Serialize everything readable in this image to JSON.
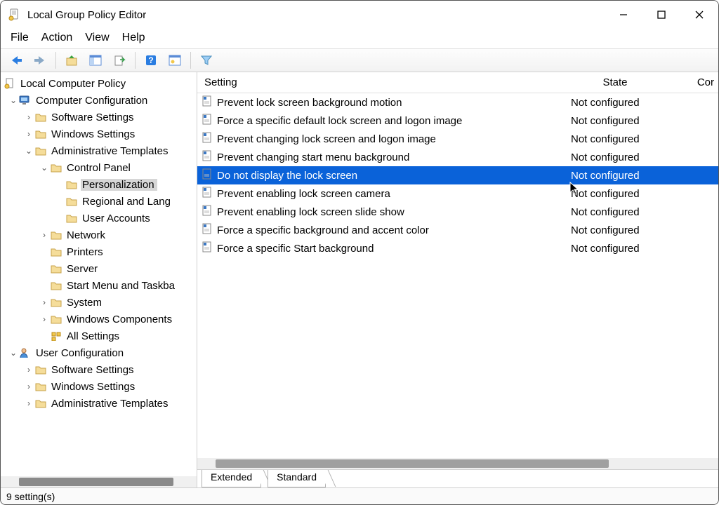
{
  "window": {
    "title": "Local Group Policy Editor"
  },
  "menu": {
    "file": "File",
    "action": "Action",
    "view": "View",
    "help": "Help"
  },
  "tree": {
    "root": "Local Computer Policy",
    "computer_cfg": "Computer Configuration",
    "sw_settings": "Software Settings",
    "win_settings": "Windows Settings",
    "admin_templates": "Administrative Templates",
    "control_panel": "Control Panel",
    "personalization": "Personalization",
    "regional": "Regional and Lang",
    "user_accounts": "User Accounts",
    "network": "Network",
    "printers": "Printers",
    "server": "Server",
    "startmenu": "Start Menu and Taskba",
    "system": "System",
    "win_components": "Windows Components",
    "all_settings": "All Settings",
    "user_cfg": "User Configuration",
    "u_sw_settings": "Software Settings",
    "u_win_settings": "Windows Settings",
    "u_admin_templates": "Administrative Templates"
  },
  "columns": {
    "setting": "Setting",
    "state": "State",
    "comment": "Cor"
  },
  "state_text": {
    "not_configured": "Not configured"
  },
  "settings": [
    {
      "name": "Prevent lock screen background motion"
    },
    {
      "name": "Force a specific default lock screen and logon image"
    },
    {
      "name": "Prevent changing lock screen and logon image"
    },
    {
      "name": "Prevent changing start menu background"
    },
    {
      "name": "Do not display the lock screen",
      "selected": true
    },
    {
      "name": "Prevent enabling lock screen camera"
    },
    {
      "name": "Prevent enabling lock screen slide show"
    },
    {
      "name": "Force a specific background and accent color"
    },
    {
      "name": "Force a specific Start background"
    }
  ],
  "tabs": {
    "extended": "Extended",
    "standard": "Standard"
  },
  "status": "9 setting(s)"
}
